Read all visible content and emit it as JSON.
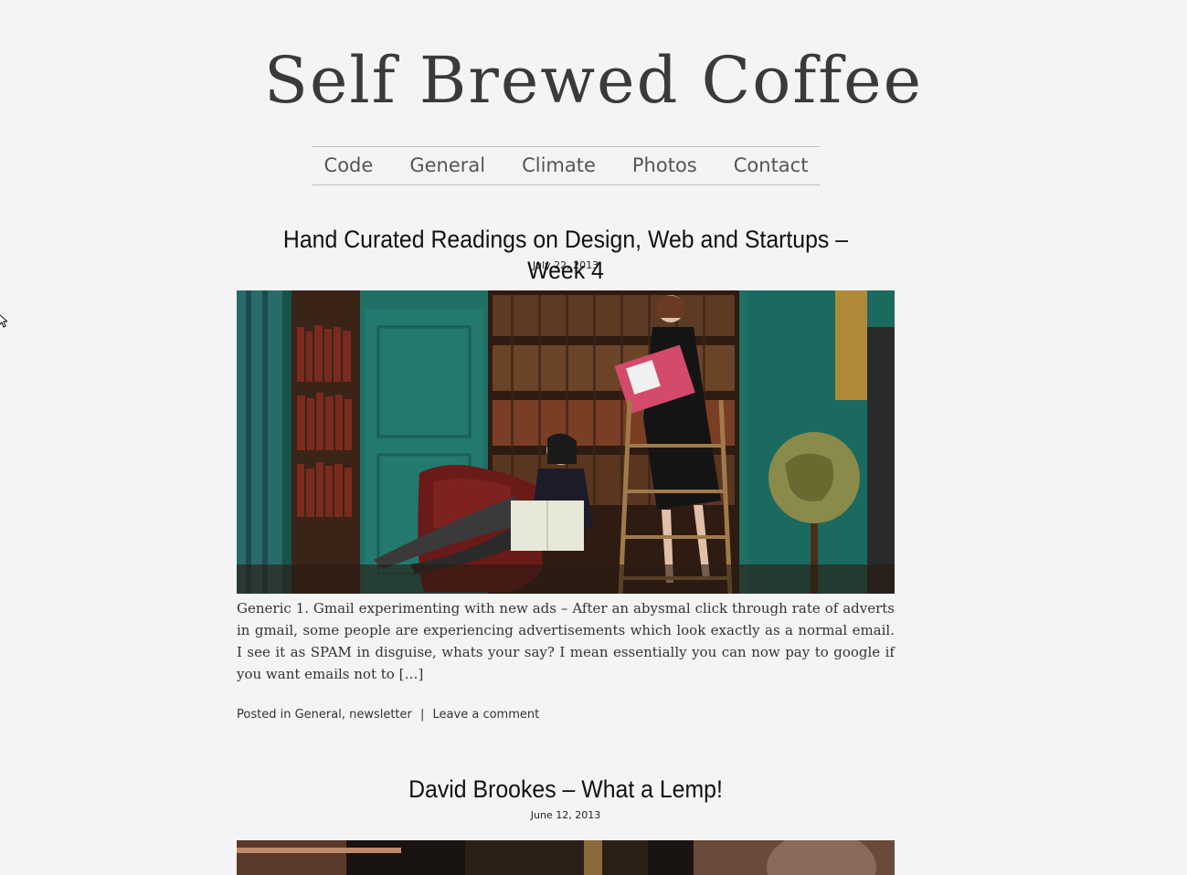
{
  "site": {
    "title": "Self Brewed Coffee"
  },
  "nav": {
    "items": [
      {
        "label": "Code"
      },
      {
        "label": "General"
      },
      {
        "label": "Climate"
      },
      {
        "label": "Photos"
      },
      {
        "label": "Contact"
      }
    ]
  },
  "posts": [
    {
      "title": "Hand Curated Readings on Design, Web and Startups – Week 4",
      "date": "July 22, 2013",
      "excerpt": "Generic 1. Gmail experimenting with new ads – After an abysmal click through rate of adverts in gmail, some people are experiencing advertisements which look exactly as a normal email. I see it as SPAM in disguise, whats your say? I mean essentially you can now pay to google if you want emails not to […]",
      "meta": {
        "posted_in": "Posted in",
        "categories": [
          "General",
          "newsletter"
        ],
        "separator": "|",
        "comment_link": "Leave a comment"
      }
    },
    {
      "title": "David Brookes – What a Lemp!",
      "date": "June 12, 2013"
    }
  ],
  "colors": {
    "background": "#f4f4f4",
    "teal_wall": "#1f6f64",
    "nav_border": "#bdbdbd"
  },
  "icons": {
    "cursor": "mouse-pointer-icon"
  }
}
